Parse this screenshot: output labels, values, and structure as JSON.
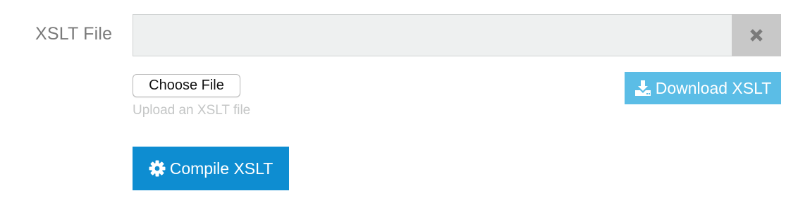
{
  "form": {
    "xslt_label": "XSLT File",
    "file_value": "",
    "choose_file_label": "Choose File",
    "help_text": "Upload an XSLT file",
    "download_label": "Download XSLT",
    "compile_label": "Compile XSLT"
  },
  "icons": {
    "clear": "times-icon",
    "download": "download-icon",
    "compile": "gear-icon"
  },
  "colors": {
    "download_button": "#5bbde6",
    "compile_button": "#0e8dd1",
    "clear_button": "#c8c8c8",
    "file_display_bg": "#eef0f0"
  }
}
